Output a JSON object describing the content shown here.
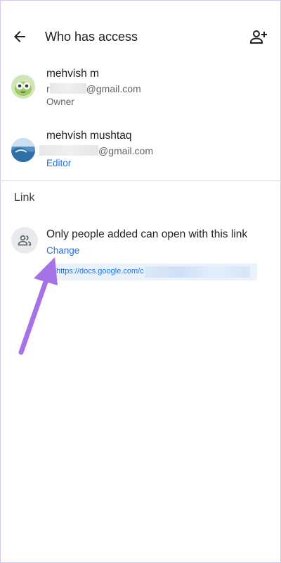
{
  "header": {
    "title": "Who has access",
    "back_icon": "arrow-back-icon",
    "add_icon": "person-add-icon"
  },
  "people": [
    {
      "name": "mehvish m",
      "email_prefix": "r",
      "email_domain": "@gmail.com",
      "role": "Owner",
      "avatar_icon": "cartoon-bird-avatar"
    },
    {
      "name": "mehvish mushtaq",
      "email_prefix": "",
      "email_domain": "@gmail.com",
      "role": "Editor",
      "avatar_icon": "photo-avatar"
    }
  ],
  "link_section": {
    "title": "Link",
    "icon": "people-icon",
    "description": "Only people added can open with this link",
    "change_label": "Change",
    "url_visible": "https://docs.google.com/c"
  },
  "colors": {
    "accent": "#1a73e8",
    "annotation_arrow": "#a673e6"
  }
}
